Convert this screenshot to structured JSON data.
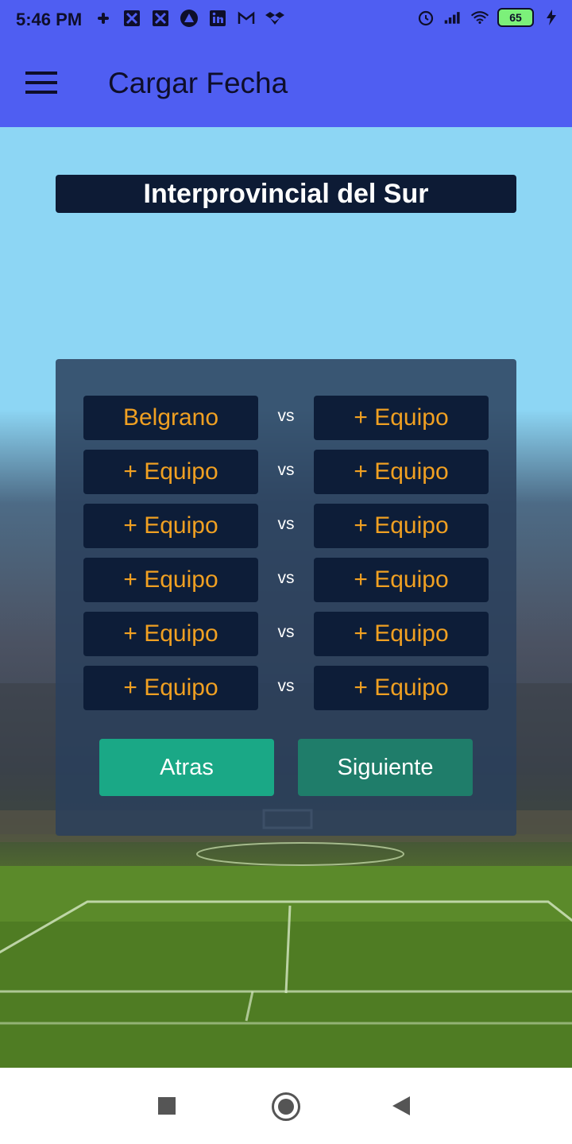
{
  "status_bar": {
    "time": "5:46 PM",
    "battery": "65",
    "left_icons": [
      "slack-icon",
      "app-icon",
      "app-icon",
      "triangle-app-icon",
      "linkedin-icon",
      "gmail-icon",
      "dropbox-icon"
    ],
    "right_icons": [
      "alarm-icon",
      "signal-icon",
      "wifi-icon",
      "battery-icon",
      "charging-icon"
    ]
  },
  "app_bar": {
    "title": "Cargar Fecha",
    "menu_icon": "menu-icon"
  },
  "league": {
    "name": "Interprovincial del Sur"
  },
  "matches": [
    {
      "home": "Belgrano",
      "vs": "vs",
      "away": "+ Equipo"
    },
    {
      "home": "+ Equipo",
      "vs": "vs",
      "away": "+ Equipo"
    },
    {
      "home": "+ Equipo",
      "vs": "vs",
      "away": "+ Equipo"
    },
    {
      "home": "+ Equipo",
      "vs": "vs",
      "away": "+ Equipo"
    },
    {
      "home": "+ Equipo",
      "vs": "vs",
      "away": "+ Equipo"
    },
    {
      "home": "+ Equipo",
      "vs": "vs",
      "away": "+ Equipo"
    }
  ],
  "actions": {
    "back_label": "Atras",
    "next_label": "Siguiente"
  },
  "colors": {
    "app_bar": "#4f5ef2",
    "team_button_bg": "#0d1d38",
    "team_text": "#f0a022",
    "back_button": "#1aa886",
    "next_button": "#1f7d6a"
  }
}
